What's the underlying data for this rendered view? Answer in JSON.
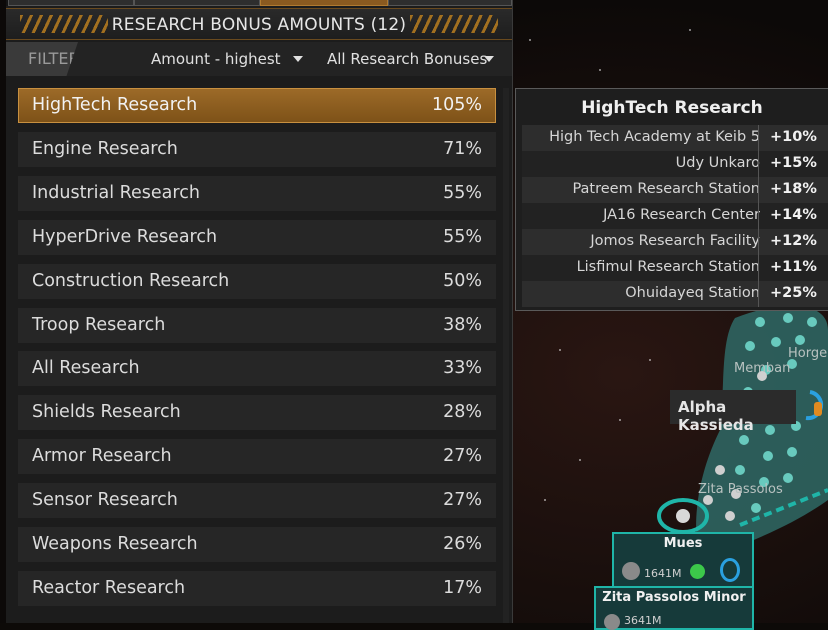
{
  "panel": {
    "title": "RESEARCH BONUS AMOUNTS (12)",
    "filter_label": "FILTER",
    "sort_dropdown": "Amount - highest",
    "type_dropdown": "All Research Bonuses"
  },
  "bonuses": [
    {
      "name": "HighTech Research",
      "value": "105%"
    },
    {
      "name": "Engine Research",
      "value": "71%"
    },
    {
      "name": "Industrial Research",
      "value": "55%"
    },
    {
      "name": "HyperDrive Research",
      "value": "55%"
    },
    {
      "name": "Construction Research",
      "value": "50%"
    },
    {
      "name": "Troop Research",
      "value": "38%"
    },
    {
      "name": "All Research",
      "value": "33%"
    },
    {
      "name": "Shields Research",
      "value": "28%"
    },
    {
      "name": "Armor Research",
      "value": "27%"
    },
    {
      "name": "Sensor Research",
      "value": "27%"
    },
    {
      "name": "Weapons Research",
      "value": "26%"
    },
    {
      "name": "Reactor Research",
      "value": "17%"
    }
  ],
  "tooltip": {
    "title": "HighTech Research",
    "rows": [
      {
        "source": "High Tech Academy at Keib 5",
        "amount": "+10%"
      },
      {
        "source": "Udy Unkaro",
        "amount": "+15%"
      },
      {
        "source": "Patreem Research Station",
        "amount": "+18%"
      },
      {
        "source": "JA16 Research Center",
        "amount": "+14%"
      },
      {
        "source": "Jomos Research Facility",
        "amount": "+12%"
      },
      {
        "source": "Lisfimul Research Station",
        "amount": "+11%"
      },
      {
        "source": "Ohuidayeq Station",
        "amount": "+25%"
      }
    ]
  },
  "map": {
    "labels": {
      "horge": "Horge",
      "memban": "Memban",
      "alpha_kassieda": "Alpha Kassieda",
      "zita_passolos": "Zita Passolos",
      "mues": "Mues",
      "mues_population": "1641M",
      "zita_passolos_minor": "Zita Passolos Minor",
      "zita_minor_population": "3641M"
    }
  },
  "colors": {
    "accent": "#9c6a28",
    "panel_bg": "#1c1c1c",
    "map_teal": "#1fb5a8"
  }
}
